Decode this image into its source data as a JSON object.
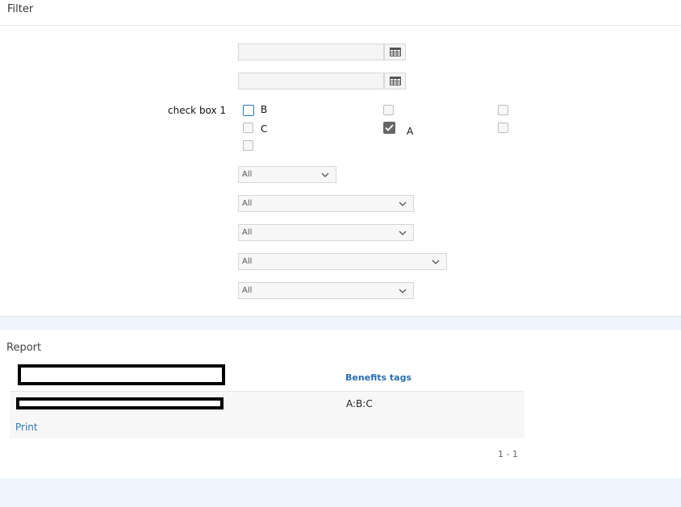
{
  "filter": {
    "title": "Filter",
    "date_inputs": [
      {
        "value": "",
        "placeholder": ""
      },
      {
        "value": "",
        "placeholder": ""
      }
    ],
    "checkbox_group": {
      "label": "check box 1",
      "items": [
        {
          "label": "B",
          "checked": false,
          "focused": true
        },
        {
          "label": "",
          "checked": false
        },
        {
          "label": "",
          "checked": false
        },
        {
          "label": "C",
          "checked": false
        },
        {
          "label": "A",
          "checked": true
        },
        {
          "label": "",
          "checked": false
        },
        {
          "label": "",
          "checked": false
        }
      ]
    },
    "selects": [
      {
        "value": "All"
      },
      {
        "value": "All"
      },
      {
        "value": "All"
      },
      {
        "value": "All"
      },
      {
        "value": "All"
      }
    ]
  },
  "report": {
    "title": "Report",
    "columns": [
      "",
      "Benefits tags"
    ],
    "rows": [
      {
        "cells": [
          "",
          "A:B:C"
        ]
      }
    ],
    "print_label": "Print",
    "pagination": "1 - 1"
  },
  "icons": {
    "calendar": "calendar-icon",
    "dropdown": "chevron-down-icon",
    "check": "check-icon"
  },
  "colors": {
    "accent": "#2b77c0",
    "header_link": "#2a6fb0",
    "band": "#eef4fb"
  }
}
